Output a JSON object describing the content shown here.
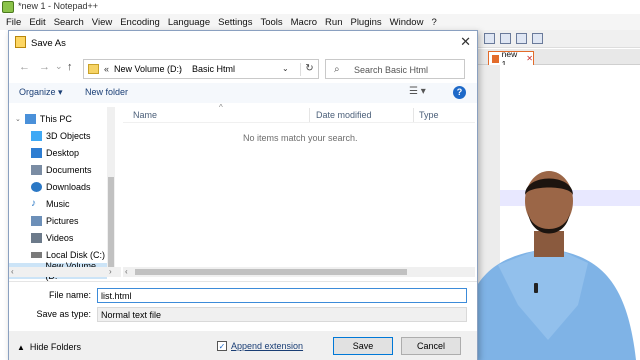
{
  "app": {
    "title": "*new 1 - Notepad++",
    "menu": [
      "File",
      "Edit",
      "Search",
      "View",
      "Encoding",
      "Language",
      "Settings",
      "Tools",
      "Macro",
      "Run",
      "Plugins",
      "Window",
      "?"
    ],
    "tab_label": "new 1"
  },
  "dialog": {
    "title": "Save As",
    "address": {
      "chevron": "«",
      "segments": [
        "New Volume (D:)",
        "Basic Html"
      ],
      "separator": "›"
    },
    "search_placeholder": "Search Basic Html",
    "organize_label": "Organize ▾",
    "new_folder_label": "New folder",
    "nav_items": [
      {
        "label": "This PC",
        "icon": "computer-icon",
        "color": "#4a90d9"
      },
      {
        "label": "3D Objects",
        "icon": "cube-icon",
        "color": "#3fa9f5"
      },
      {
        "label": "Desktop",
        "icon": "desktop-icon",
        "color": "#2d7dd2"
      },
      {
        "label": "Documents",
        "icon": "documents-icon",
        "color": "#7a8ca3"
      },
      {
        "label": "Downloads",
        "icon": "download-icon",
        "color": "#2b78c5"
      },
      {
        "label": "Music",
        "icon": "music-icon",
        "color": "#2b78c5"
      },
      {
        "label": "Pictures",
        "icon": "pictures-icon",
        "color": "#6c8fb8"
      },
      {
        "label": "Videos",
        "icon": "video-icon",
        "color": "#6c7a8a"
      },
      {
        "label": "Local Disk (C:)",
        "icon": "disk-icon",
        "color": "#7a7a7a"
      },
      {
        "label": "New Volume (D:",
        "icon": "disk-icon",
        "color": "#7a7a7a"
      }
    ],
    "columns": [
      "Name",
      "Date modified",
      "Type"
    ],
    "empty_message": "No items match your search.",
    "file_name_label": "File name:",
    "file_name_value": "list.html",
    "save_type_label": "Save as type:",
    "save_type_value": "Normal text file",
    "hide_folders_label": "Hide Folders",
    "append_extension_label": "Append extension",
    "append_checked": "✓",
    "save_label": "Save",
    "cancel_label": "Cancel"
  }
}
